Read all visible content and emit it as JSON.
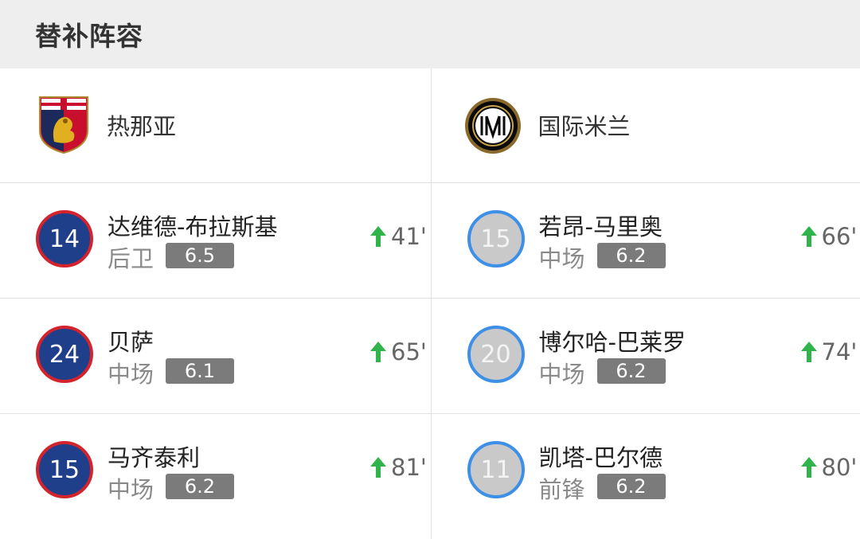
{
  "header": {
    "title": "替补阵容"
  },
  "teams": {
    "home": {
      "name": "热那亚",
      "logo_icon": "genoa-crest-icon"
    },
    "away": {
      "name": "国际米兰",
      "logo_icon": "inter-crest-icon"
    }
  },
  "colors": {
    "home_jersey_fill": "#1f3f8a",
    "home_jersey_ring": "#d3242e",
    "away_jersey_fill": "#c9c9c9",
    "away_jersey_ring": "#3d8fe8",
    "sub_arrow": "#2fb34a",
    "rating_bg": "#7b7b7b"
  },
  "substitutes": {
    "home": [
      {
        "number": "14",
        "name": "达维德-布拉斯基",
        "position": "后卫",
        "rating": "6.5",
        "minute": "41'"
      },
      {
        "number": "24",
        "name": "贝萨",
        "position": "中场",
        "rating": "6.1",
        "minute": "65'"
      },
      {
        "number": "15",
        "name": "马齐泰利",
        "position": "中场",
        "rating": "6.2",
        "minute": "81'"
      }
    ],
    "away": [
      {
        "number": "15",
        "name": "若昂-马里奥",
        "position": "中场",
        "rating": "6.2",
        "minute": "66'"
      },
      {
        "number": "20",
        "name": "博尔哈-巴莱罗",
        "position": "中场",
        "rating": "6.2",
        "minute": "74'"
      },
      {
        "number": "11",
        "name": "凯塔-巴尔德",
        "position": "前锋",
        "rating": "6.2",
        "minute": "80'"
      }
    ]
  }
}
